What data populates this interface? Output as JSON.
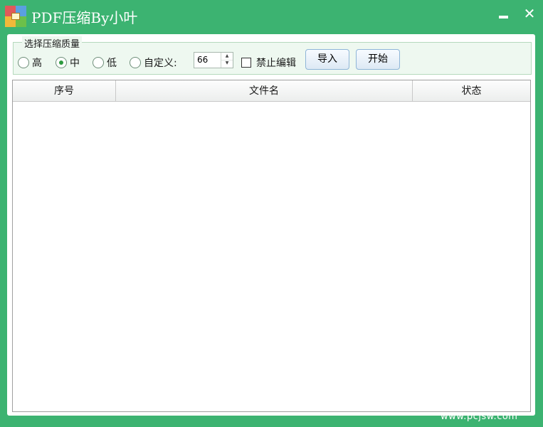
{
  "window": {
    "title": "PDF压缩By小叶",
    "minimize_symbol": "—",
    "close_symbol": "✕",
    "icon": "winrar-archive-icon"
  },
  "compression": {
    "group_title": "选择压缩质量",
    "options": [
      {
        "label": "高",
        "checked": false
      },
      {
        "label": "中",
        "checked": true
      },
      {
        "label": "低",
        "checked": false
      },
      {
        "label": "自定义:",
        "checked": false
      }
    ],
    "custom_value": "66",
    "spin_up": "▲",
    "spin_down": "▼",
    "disable_edit_label": "禁止编辑",
    "disable_edit_checked": false,
    "import_label": "导入",
    "start_label": "开始"
  },
  "table": {
    "columns": [
      "序号",
      "文件名",
      "状态"
    ],
    "rows": []
  },
  "watermark": "www.pcjsw.com"
}
